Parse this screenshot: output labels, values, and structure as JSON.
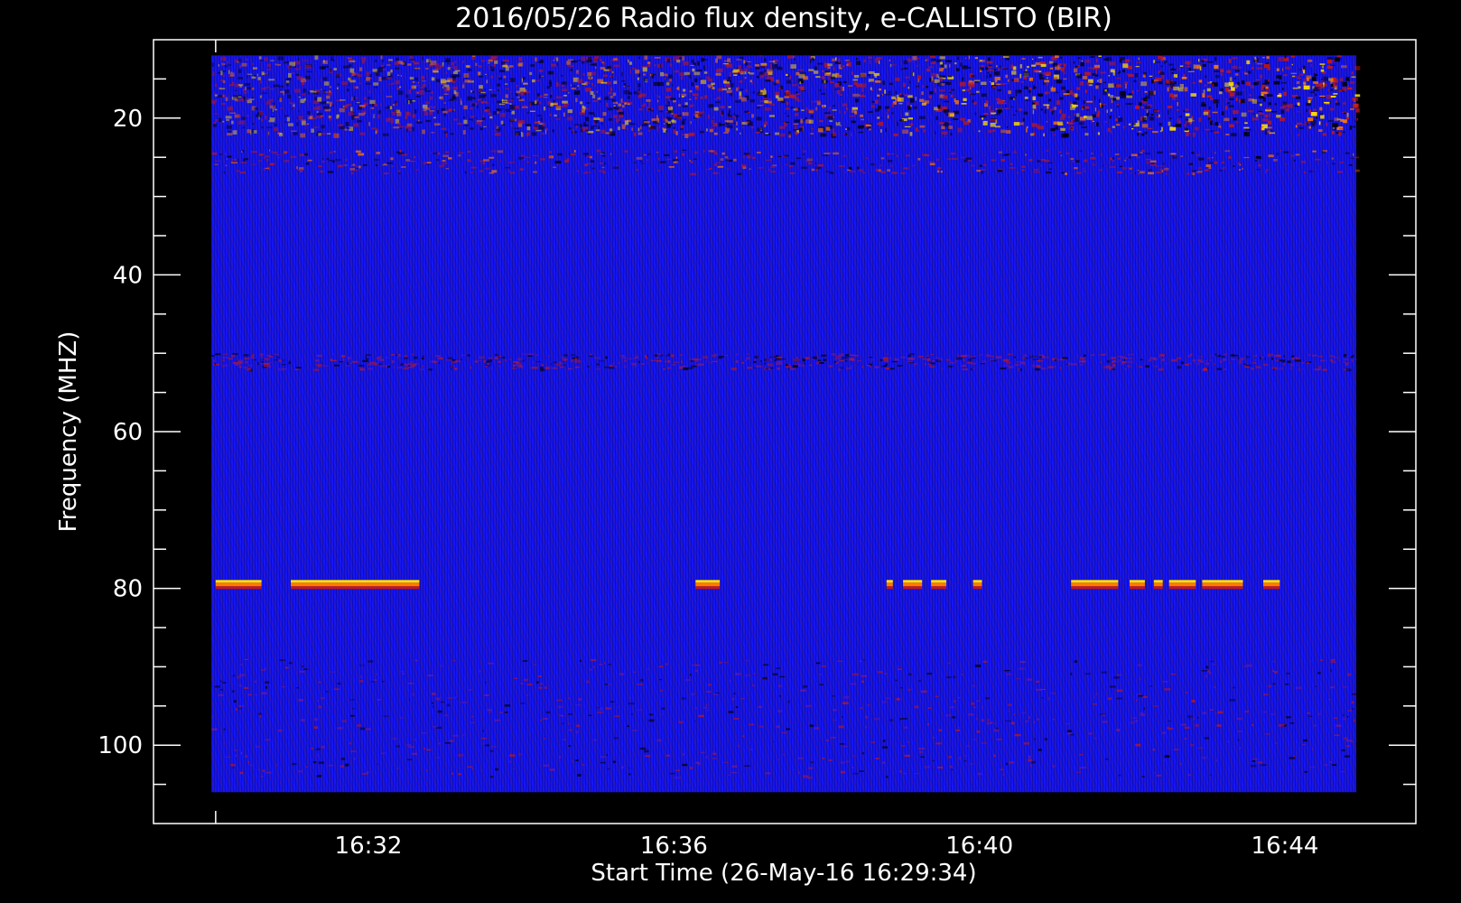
{
  "chart_data": {
    "type": "heatmap",
    "title": "2016/05/26  Radio flux density, e-CALLISTO (BIR)",
    "xlabel": "Start Time (26-May-16 16:29:34)",
    "ylabel": "Frequency (MHZ)",
    "y_axis": {
      "direction": "increasing-downward",
      "range": [
        10,
        110
      ],
      "data_range": [
        12,
        106
      ],
      "major_ticks": [
        20,
        40,
        60,
        80,
        100
      ],
      "tick_labels": [
        "20",
        "40",
        "60",
        "80",
        "100"
      ],
      "minor_step": 5
    },
    "x_axis": {
      "range_minutes_of_day": [
        1008.2,
        1024.8
      ],
      "data_range_minutes_of_day": [
        1009.57,
        1024.6
      ],
      "major_ticks": [
        "16:32",
        "16:36",
        "16:40",
        "16:44"
      ],
      "tick_minutes_of_day": [
        992,
        996,
        1000,
        1004
      ],
      "minor_step_minutes": 1
    },
    "colormap": {
      "background": "#1414ee",
      "low": "#000000",
      "mid": "#c01818",
      "high": "#ff7a00",
      "peak": "#ffe000"
    },
    "features": [
      {
        "kind": "band",
        "freq_range": [
          12,
          22
        ],
        "intensity": "high",
        "notes": "bright interference band, strongest after 16:39"
      },
      {
        "kind": "band",
        "freq_range": [
          24,
          27
        ],
        "intensity": "medium"
      },
      {
        "kind": "band",
        "freq_range": [
          50,
          52
        ],
        "intensity": "low"
      },
      {
        "kind": "band",
        "freq_range": [
          89,
          104
        ],
        "intensity": "low"
      },
      {
        "kind": "burst_line",
        "freq": 79.5,
        "segments": [
          [
            "16:30:00",
            "16:30:36"
          ],
          [
            "16:30:59",
            "16:32:40"
          ],
          [
            "16:36:17",
            "16:36:36"
          ],
          [
            "16:38:47",
            "16:38:52"
          ],
          [
            "16:39:00",
            "16:39:15"
          ],
          [
            "16:39:22",
            "16:39:34"
          ],
          [
            "16:39:55",
            "16:40:02"
          ],
          [
            "16:41:12",
            "16:41:49"
          ],
          [
            "16:41:58",
            "16:42:10"
          ],
          [
            "16:42:17",
            "16:42:24"
          ],
          [
            "16:42:29",
            "16:42:50"
          ],
          [
            "16:42:55",
            "16:43:27"
          ],
          [
            "16:43:43",
            "16:43:56"
          ]
        ]
      }
    ]
  }
}
